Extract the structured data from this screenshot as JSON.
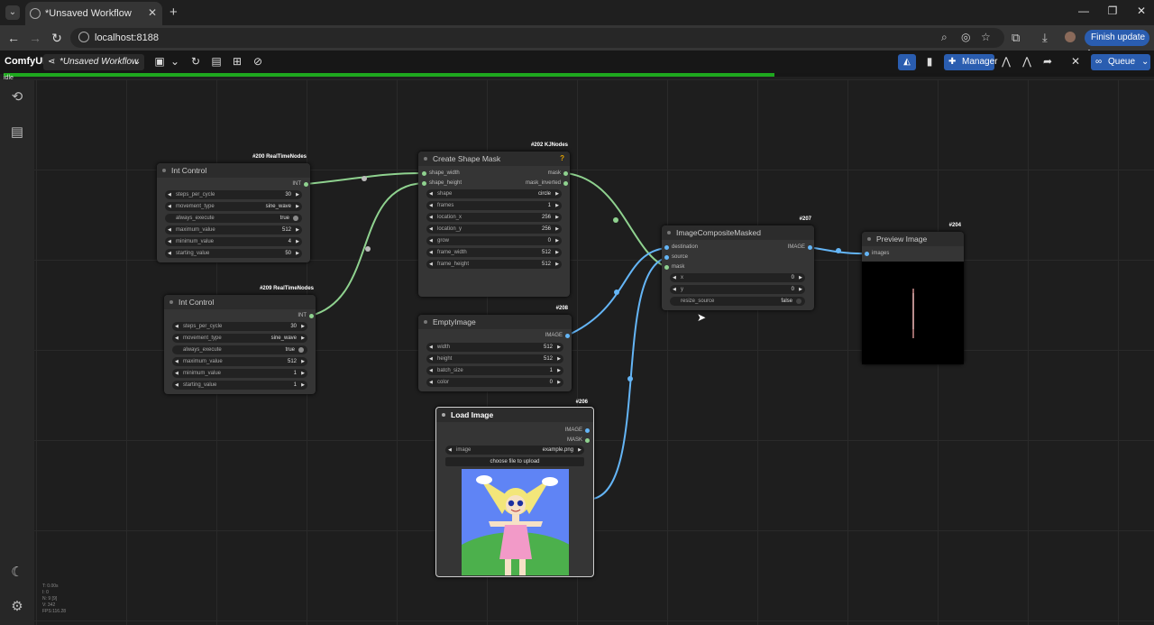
{
  "browser": {
    "tab_title": "*Unsaved Workflow",
    "url": "localhost:8188",
    "finish_update": "Finish update"
  },
  "comfy": {
    "logo": "ComfyUI",
    "workflow_name": "*Unsaved Workflow",
    "manager_label": "Manager",
    "queue_label": "Queue",
    "status": "idle",
    "progress": 0.67
  },
  "nodes": {
    "int_control_200": {
      "badge": "#200 RealTimeNodes",
      "title": "Int Control",
      "output": "INT",
      "widgets": [
        {
          "label": "steps_per_cycle",
          "value": "30"
        },
        {
          "label": "movement_type",
          "value": "sine_wave"
        },
        {
          "label": "always_execute",
          "value": "true"
        },
        {
          "label": "maximum_value",
          "value": "512"
        },
        {
          "label": "minimum_value",
          "value": "4"
        },
        {
          "label": "starting_value",
          "value": "50"
        }
      ]
    },
    "int_control_209": {
      "badge": "#209 RealTimeNodes",
      "title": "Int Control",
      "output": "INT",
      "widgets": [
        {
          "label": "steps_per_cycle",
          "value": "30"
        },
        {
          "label": "movement_type",
          "value": "sine_wave"
        },
        {
          "label": "always_execute",
          "value": "true"
        },
        {
          "label": "maximum_value",
          "value": "512"
        },
        {
          "label": "minimum_value",
          "value": "1"
        },
        {
          "label": "starting_value",
          "value": "1"
        }
      ]
    },
    "shape_mask": {
      "badge": "#202 KJNodes",
      "title": "Create Shape Mask",
      "warn": "?",
      "inputs": [
        "shape_width",
        "shape_height"
      ],
      "outputs": [
        "mask",
        "mask_inverted"
      ],
      "widgets": [
        {
          "label": "shape",
          "value": "circle"
        },
        {
          "label": "frames",
          "value": "1"
        },
        {
          "label": "location_x",
          "value": "256"
        },
        {
          "label": "location_y",
          "value": "256"
        },
        {
          "label": "grow",
          "value": "0"
        },
        {
          "label": "frame_width",
          "value": "512"
        },
        {
          "label": "frame_height",
          "value": "512"
        }
      ]
    },
    "empty_image": {
      "badge": "#208",
      "title": "EmptyImage",
      "output": "IMAGE",
      "widgets": [
        {
          "label": "width",
          "value": "512"
        },
        {
          "label": "height",
          "value": "512"
        },
        {
          "label": "batch_size",
          "value": "1"
        },
        {
          "label": "color",
          "value": "0"
        }
      ]
    },
    "load_image": {
      "badge": "#206",
      "title": "Load Image",
      "outputs": [
        "IMAGE",
        "MASK"
      ],
      "widget": {
        "label": "image",
        "value": "example.png"
      },
      "upload": "choose file to upload"
    },
    "composite": {
      "badge": "#207",
      "title": "ImageCompositeMasked",
      "inputs": [
        "destination",
        "source",
        "mask"
      ],
      "output": "IMAGE",
      "widgets": [
        {
          "label": "x",
          "value": "0"
        },
        {
          "label": "y",
          "value": "0"
        },
        {
          "label": "resize_source",
          "value": "false"
        }
      ]
    },
    "preview": {
      "badge": "#204",
      "title": "Preview Image",
      "input": "images"
    }
  },
  "stats": [
    "T: 0.00s",
    "I: 0",
    "N: 9 [9]",
    "V: 342",
    "FPS:116.28"
  ],
  "colors": {
    "int_link": "#8fd28f",
    "image_link": "#64b5f6",
    "progress": "#1ea81e",
    "accent": "#2a5db0"
  }
}
